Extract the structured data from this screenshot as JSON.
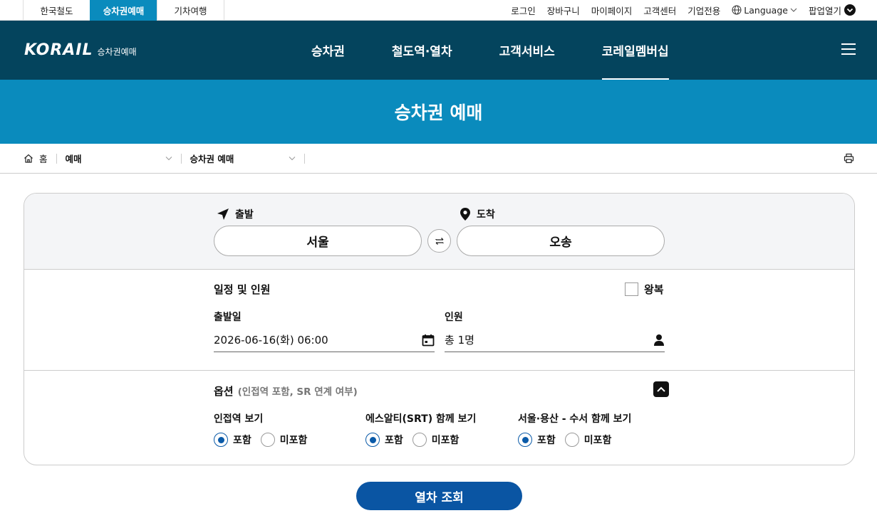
{
  "util": {
    "tabs": [
      {
        "label": "한국철도"
      },
      {
        "label": "승차권예매"
      },
      {
        "label": "기차여행"
      }
    ],
    "links": [
      "로그인",
      "장바구니",
      "마이페이지",
      "고객센터",
      "기업전용"
    ],
    "language": "Language",
    "popup": "팝업열기"
  },
  "header": {
    "brand": "KORAIL",
    "sub": "승차권예매",
    "nav": [
      "승차권",
      "철도역·열차",
      "고객서비스",
      "코레일멤버십"
    ]
  },
  "hero": {
    "title": "승차권 예매"
  },
  "breadcrumb": {
    "home": "홈",
    "level1": "예매",
    "level2": "승차권 예매"
  },
  "route": {
    "departure_label": "출발",
    "arrival_label": "도착",
    "departure": "서울",
    "arrival": "오송"
  },
  "schedule": {
    "title": "일정 및 인원",
    "roundtrip_label": "왕복",
    "roundtrip_checked": false,
    "date_label": "출발일",
    "date_value": "2026-06-16(화) 06:00",
    "pax_label": "인원",
    "pax_value": "총 1명"
  },
  "options": {
    "title": "옵션",
    "note": "(인접역 포함, SR 연계 여부)",
    "groups": [
      {
        "title": "인접역 보기",
        "include": "포함",
        "exclude": "미포함",
        "selected": "포함"
      },
      {
        "title": "에스알티(SRT) 함께 보기",
        "include": "포함",
        "exclude": "미포함",
        "selected": "포함"
      },
      {
        "title": "서울·용산 - 수서 함께 보기",
        "include": "포함",
        "exclude": "미포함",
        "selected": "포함"
      }
    ]
  },
  "search_button": "열차 조회",
  "colors": {
    "header": "#04445d",
    "accent": "#0a8bbd",
    "primary": "#0a55a3"
  }
}
